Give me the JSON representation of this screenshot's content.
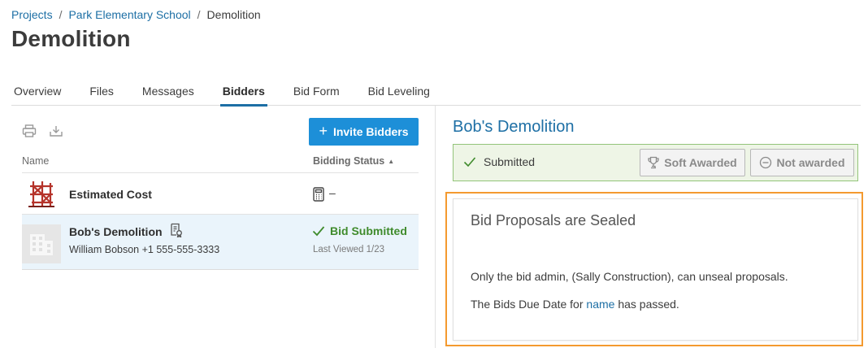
{
  "breadcrumb": {
    "items": [
      "Projects",
      "Park Elementary School",
      "Demolition"
    ],
    "separator": "/"
  },
  "page_title": "Demolition",
  "tabs": [
    "Overview",
    "Files",
    "Messages",
    "Bidders",
    "Bid Form",
    "Bid Leveling"
  ],
  "active_tab": "Bidders",
  "bidders_list": {
    "invite_button": "Invite Bidders",
    "columns": {
      "name": "Name",
      "status": "Bidding Status"
    },
    "estimated_row": {
      "label": "Estimated Cost",
      "value": "–"
    },
    "bidder_row": {
      "name": "Bob's Demolition",
      "contact": "William Bobson +1 555-555-3333",
      "status": "Bid Submitted",
      "last_viewed": "Last Viewed 1/23"
    }
  },
  "detail": {
    "title": "Bob's Demolition",
    "status_label": "Submitted",
    "soft_awarded": "Soft Awarded",
    "not_awarded": "Not awarded",
    "sealed": {
      "heading": "Bid Proposals are Sealed",
      "line1": "Only the bid admin, (Sally Construction), can unseal proposals.",
      "line2_prefix": "The Bids Due Date for ",
      "line2_link": "name",
      "line2_suffix": " has passed."
    }
  },
  "colors": {
    "link": "#1d6fa5",
    "primary_button": "#1d8fd8",
    "success": "#3f8b2c",
    "highlight_border": "#f49a2f"
  }
}
